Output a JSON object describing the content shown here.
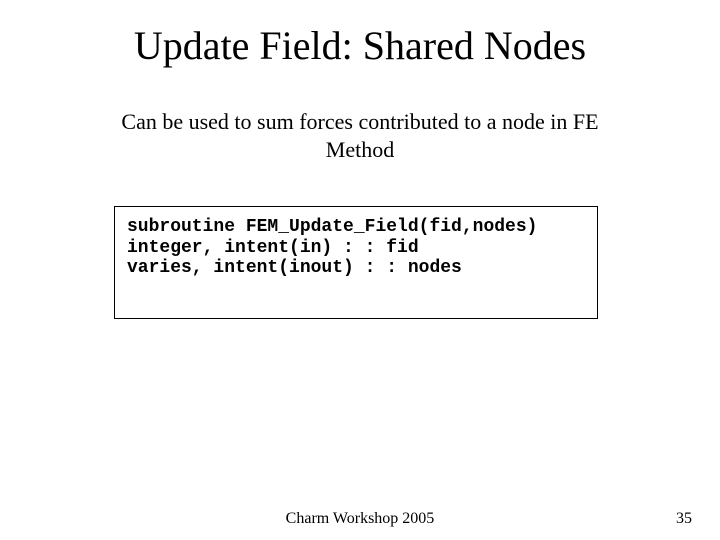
{
  "title": "Update Field: Shared Nodes",
  "description": "Can be used to sum forces contributed to a node in FE Method",
  "code": {
    "line1": "subroutine FEM_Update_Field(fid,nodes)",
    "line2": "integer, intent(in) : : fid",
    "line3": "varies, intent(inout) : : nodes"
  },
  "footer": {
    "center": "Charm Workshop 2005",
    "page": "35"
  }
}
